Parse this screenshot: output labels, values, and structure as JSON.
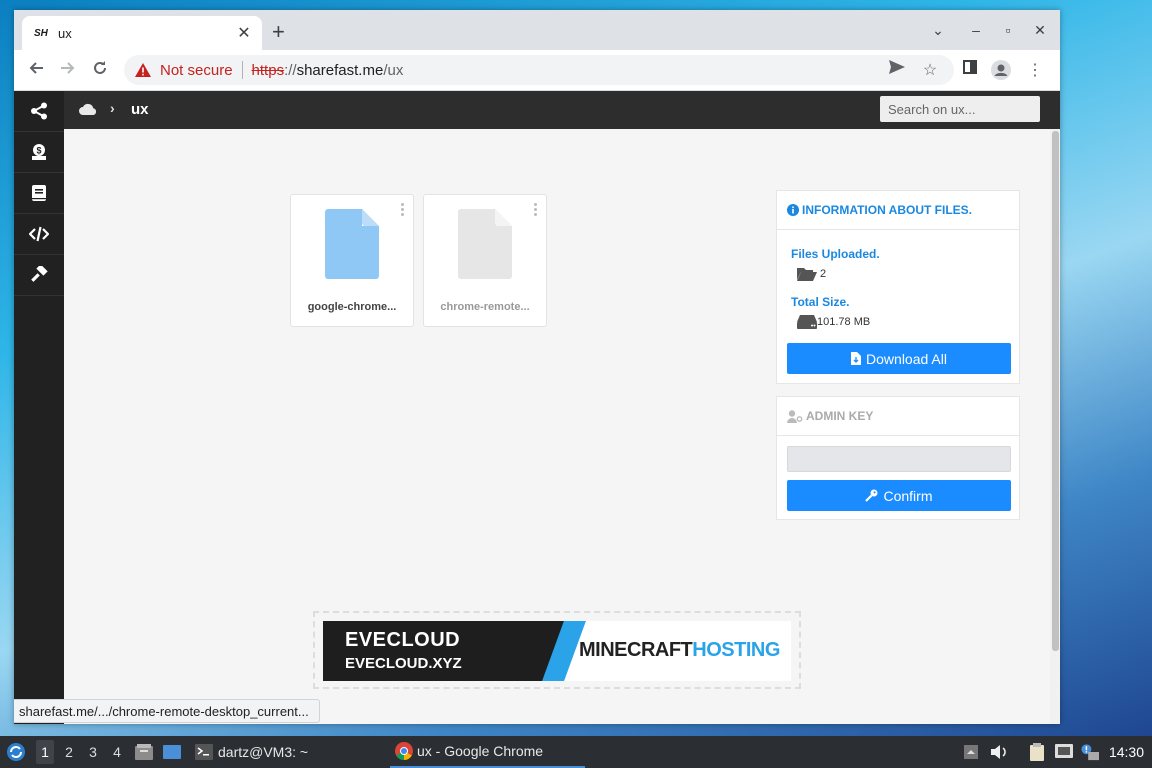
{
  "browser": {
    "tab_title": "ux",
    "tab_favicon_text": "SH",
    "security_label": "Not secure",
    "url_scheme": "https",
    "url_colon": "://",
    "url_host": "sharefast.me",
    "url_path": "/ux",
    "status_url": "sharefast.me/.../chrome-remote-desktop_current..."
  },
  "sidebar": {
    "items": [
      {
        "icon": "share-icon"
      },
      {
        "icon": "money-bag-icon"
      },
      {
        "icon": "book-icon"
      },
      {
        "icon": "code-icon"
      },
      {
        "icon": "hammer-icon"
      }
    ]
  },
  "topbar": {
    "breadcrumb_current": "ux",
    "search_placeholder": "Search on ux..."
  },
  "files": [
    {
      "name": "google-chrome...",
      "color": "#90c8f5",
      "selected": true
    },
    {
      "name": "chrome-remote...",
      "color": "#e6e6e6",
      "selected": false
    }
  ],
  "info_panel": {
    "heading": "INFORMATION ABOUT FILES.",
    "files_uploaded_label": "Files Uploaded.",
    "files_uploaded_value": "2",
    "total_size_label": "Total Size.",
    "total_size_value": "101.78 MB",
    "download_label": "Download All"
  },
  "admin_panel": {
    "heading": "ADMIN KEY",
    "input_value": "",
    "confirm_label": "Confirm"
  },
  "ad": {
    "brand": "EVECLOUD",
    "domain": "EVECLOUD.XYZ",
    "tagline_a": "MINECRAFT",
    "tagline_b": "HOSTING"
  },
  "taskbar": {
    "workspaces": [
      "1",
      "2",
      "3",
      "4"
    ],
    "active_workspace": "1",
    "terminal_task": "dartz@VM3: ~",
    "chrome_task": "ux - Google Chrome",
    "clock": "14:30"
  },
  "colors": {
    "accent": "#1a8cff",
    "info_text": "#1a88e0",
    "sidebar_bg": "#212121",
    "warning": "#c5221f"
  }
}
